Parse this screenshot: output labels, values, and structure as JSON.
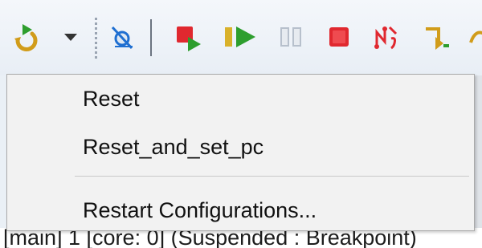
{
  "toolbar": {
    "buttons": [
      {
        "icon": "reset-icon"
      },
      {
        "icon": "dropdown-arrow-icon"
      },
      {
        "icon": "skip-breakpoints-icon"
      },
      {
        "icon": "terminate-relaunch-icon"
      },
      {
        "icon": "resume-icon"
      },
      {
        "icon": "suspend-icon"
      },
      {
        "icon": "terminate-icon"
      },
      {
        "icon": "disconnect-icon"
      },
      {
        "icon": "step-into-icon"
      },
      {
        "icon": "step-over-icon"
      }
    ],
    "colors": {
      "green": "#2e9e2e",
      "red": "#e0282f",
      "disabled": "#b7c0cc",
      "blue": "#1f6fd1",
      "gold": "#d19c1a"
    }
  },
  "menu": {
    "items": [
      {
        "label": "Reset"
      },
      {
        "label": "Reset_and_set_pc"
      },
      {
        "label": "Restart Configurations..."
      }
    ]
  },
  "background": {
    "status_text": "[main] 1 [core: 0] (Suspended : Breakpoint)"
  }
}
